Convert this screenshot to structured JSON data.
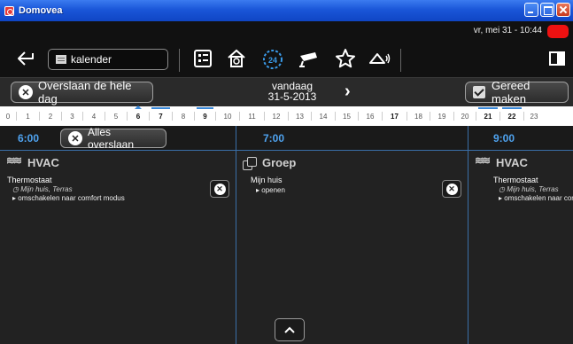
{
  "window": {
    "title": "Domovea"
  },
  "status": {
    "datetime": "vr, mei 31 - 10:44"
  },
  "toolbar": {
    "back_icon": "arrow-left-icon",
    "calendar_label": "kalender",
    "icons": [
      "list-icon",
      "home-icon",
      "24h-clock-icon",
      "camera-icon",
      "star-icon",
      "alarm-icon"
    ],
    "exit_icon": "exit-icon"
  },
  "nav": {
    "skip_day_label": "Overslaan de hele dag",
    "today_label": "vandaag",
    "date": "31-5-2013",
    "done_label": "Gereed maken"
  },
  "days": [
    {
      "n": "0"
    },
    {
      "n": "1"
    },
    {
      "n": "2"
    },
    {
      "n": "3"
    },
    {
      "n": "4"
    },
    {
      "n": "5"
    },
    {
      "n": "6",
      "bold": true,
      "current": true
    },
    {
      "n": "7",
      "bold": true,
      "marked": true
    },
    {
      "n": "8"
    },
    {
      "n": "9",
      "bold": true,
      "marked": true
    },
    {
      "n": "10"
    },
    {
      "n": "11"
    },
    {
      "n": "12"
    },
    {
      "n": "13"
    },
    {
      "n": "14"
    },
    {
      "n": "15"
    },
    {
      "n": "16"
    },
    {
      "n": "17",
      "bold": true
    },
    {
      "n": "18"
    },
    {
      "n": "19"
    },
    {
      "n": "20"
    },
    {
      "n": "21",
      "bold": true,
      "marked": true
    },
    {
      "n": "22",
      "bold": true,
      "marked": true
    },
    {
      "n": "23"
    }
  ],
  "timeline": {
    "skip_all_label": "Alles overslaan",
    "times": [
      "6:00",
      "7:00",
      "9:00"
    ]
  },
  "columns": [
    {
      "category": "HVAC",
      "icon": "hvac-icon",
      "title": "Thermostaat",
      "location": "Mijn huis, Terras",
      "action": "omschakelen naar comfort modus"
    },
    {
      "category": "Groep",
      "icon": "group-icon",
      "title": "Mijn huis",
      "location": "",
      "action": "openen"
    },
    {
      "category": "HVAC",
      "icon": "hvac-icon",
      "title": "Thermostaat",
      "location": "Mijn huis, Terras",
      "action": "omschakelen naar comfort modus"
    }
  ],
  "colors": {
    "accent": "#4fa3f0",
    "titlebar": "#1a56d8",
    "status_led": "#ee1111"
  }
}
